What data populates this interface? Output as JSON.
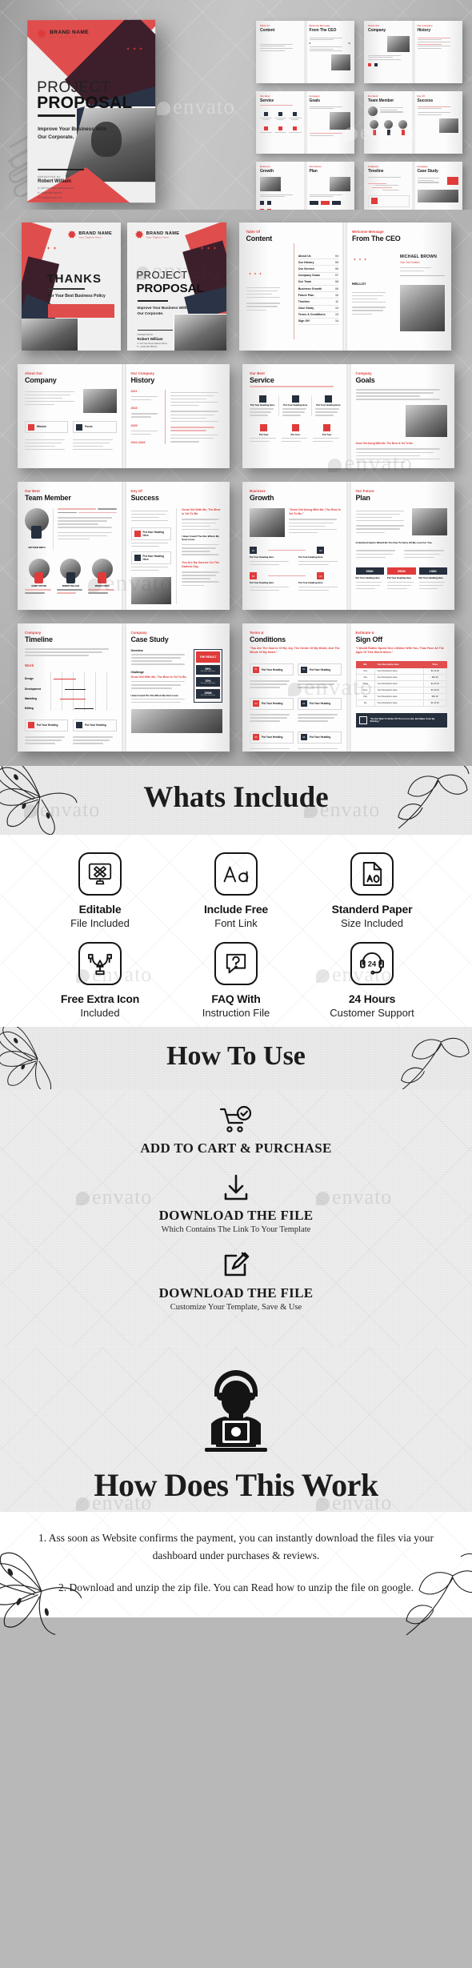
{
  "colors": {
    "accent_red": "#e04d4d",
    "dark_navy": "#2b3446",
    "maroon": "#3d1f2b",
    "ink": "#1a1a1a"
  },
  "cover": {
    "brand_name": "BRAND NAME",
    "brand_tagline": "Your Tagline Here",
    "title_line1": "PROJECT",
    "title_line2": "PROPOSAL",
    "subtitle": "Improve Your Business With Our Corporate.",
    "presented_label": "PRESENTED BY",
    "presented_name": "Robert William",
    "contact_address": "A: 123 Your Street Address Name",
    "contact_phone": "P: +(123) 456 7890 00",
    "contact_mail": "M: user@example.com"
  },
  "thumbnails": [
    {
      "left_kicker": "Table Of",
      "left_title": "Content",
      "right_kicker": "Welcome Message",
      "right_title": "From The CEO"
    },
    {
      "left_kicker": "About Our",
      "left_title": "Company",
      "right_kicker": "Our Company",
      "right_title": "History"
    },
    {
      "left_kicker": "Our Best",
      "left_title": "Service",
      "right_kicker": "Company",
      "right_title": "Goals"
    },
    {
      "left_kicker": "Our Best",
      "left_title": "Team Member",
      "right_kicker": "Key Of",
      "right_title": "Success"
    },
    {
      "left_kicker": "Business",
      "left_title": "Growth",
      "right_kicker": "Our Future",
      "right_title": "Plan"
    },
    {
      "left_kicker": "Company",
      "left_title": "Timeline",
      "right_kicker": "Company",
      "right_title": "Case Study"
    }
  ],
  "covers_row": {
    "thanks_title": "THANKS",
    "thanks_sub": "For Your Best Business Policy",
    "proposal_line1": "PROJECT",
    "proposal_line2": "PROPOSAL",
    "proposal_sub": "Improve Your Business With Our Corporate."
  },
  "spreads": [
    {
      "left": {
        "kicker": "Table Of",
        "title": "Content"
      },
      "right": {
        "kicker": "Welcome Message",
        "title": "From The CEO",
        "person": "MICHAEL BROWN",
        "person_role": "Your Job Position",
        "greeting": "HELLO!"
      },
      "toc": [
        {
          "label": "About Us",
          "page": "04"
        },
        {
          "label": "Our History",
          "page": "05"
        },
        {
          "label": "Our Service",
          "page": "06"
        },
        {
          "label": "Company Goals",
          "page": "07"
        },
        {
          "label": "Our Team",
          "page": "08"
        },
        {
          "label": "Business Growth",
          "page": "09"
        },
        {
          "label": "Future Plan",
          "page": "10"
        },
        {
          "label": "Timeline",
          "page": "11"
        },
        {
          "label": "Case Study",
          "page": "12"
        },
        {
          "label": "Terms & Conditions",
          "page": "13"
        },
        {
          "label": "Sign Off",
          "page": "14"
        }
      ]
    },
    {
      "left": {
        "kicker": "About Our",
        "title": "Company",
        "tag1": "Mission",
        "tag2": "Focus"
      },
      "right": {
        "kicker": "Our Company",
        "title": "History",
        "years": "2021-2026"
      }
    },
    {
      "left": {
        "kicker": "Our Best",
        "title": "Service",
        "cards": [
          "Put Your Heading Here",
          "Put Your Heading Here",
          "Put Your Heading Here"
        ]
      },
      "right": {
        "kicker": "Company",
        "title": "Goals",
        "quote": "Grow Old Along With Me, The Best Is Yet To Be."
      }
    },
    {
      "left": {
        "kicker": "Our Best",
        "title": "Team Member",
        "lead_name": "MATTHEW SMITH",
        "members": [
          "HENRY POTTER",
          "ROBERT WILLIAM",
          "ROBERT PRICE"
        ]
      },
      "right": {
        "kicker": "Key Of",
        "title": "Success",
        "quote": "Grow Old With Me, The Best Is Yet To Be.",
        "item1": "Put Your Heading Here",
        "item2": "Put Your Heading Here"
      }
    },
    {
      "left": {
        "kicker": "Business",
        "title": "Growth",
        "quote": "\"Grow Old Along With Me, The Best Is Yet To Be.\"",
        "steps": [
          "01",
          "02",
          "03",
          "04"
        ],
        "step_label": "Put Your Heading Here"
      },
      "right": {
        "kicker": "Our Future",
        "title": "Plan",
        "stats": [
          "990K",
          "350M",
          "150K"
        ],
        "stat_label": "Put Your Heading Here"
      }
    },
    {
      "left": {
        "kicker": "Company",
        "title": "Timeline",
        "work_label": "Work",
        "rows": [
          "Design",
          "Development",
          "Marketing",
          "Editing"
        ],
        "chip1": "Put Your Heading",
        "chip2": "Put Your Heading"
      },
      "right": {
        "kicker": "Company",
        "title": "Case Study",
        "sec1": "Overview",
        "sec2": "Challenge",
        "result": "THE RESULT",
        "metrics": [
          "99%",
          "70%",
          "250M"
        ],
        "metric_sub": "Put Your Text Here"
      }
    },
    {
      "left": {
        "kicker": "Terms &",
        "title": "Conditions",
        "quote": "\"You Are The Source Of My Joy, The Center Of My World, And The Whole Of My Heart.\"",
        "items": [
          "01",
          "02",
          "03",
          "04",
          "05",
          "06"
        ],
        "item_label": "Put Your Heading"
      },
      "right": {
        "kicker": "Estimate &",
        "title": "Sign Off",
        "quote": "\"I Would Rather Spend One Lifetime With You, Than Face All The Ages Of This World Alone.\"",
        "table_headers": [
          "NO.",
          "Your Description Here",
          "Price"
        ],
        "table_rows": [
          {
            "no": "One",
            "desc": "Your Description Here",
            "price": "$1,00.00"
          },
          {
            "no": "Two",
            "desc": "Your Description Here",
            "price": "$60.00"
          },
          {
            "no": "Three",
            "desc": "Your Description Here",
            "price": "$1,00.00"
          },
          {
            "no": "Four",
            "desc": "Your Description Here",
            "price": "$1,00.00"
          },
          {
            "no": "Five",
            "desc": "Your Description Here",
            "price": "$60.00"
          },
          {
            "no": "Six",
            "desc": "Your Description Here",
            "price": "$1,00.00"
          }
        ],
        "footer_quote": "\"Do Not Wait To Strike Till The Iron Is Hot, But Make It Hot By Striking.\""
      }
    }
  ],
  "whats_include": {
    "title": "Whats Include",
    "features": [
      {
        "icon": "editable-monitor-icon",
        "line1": "Editable",
        "line2": "File Included"
      },
      {
        "icon": "font-aa-icon",
        "line1": "Include Free",
        "line2": "Font Link"
      },
      {
        "icon": "paper-a0-icon",
        "line1": "Standerd Paper",
        "line2": "Size Included"
      },
      {
        "icon": "pen-tool-icon",
        "line1": "Free Extra Icon",
        "line2": "Included"
      },
      {
        "icon": "faq-question-icon",
        "line1": "FAQ With",
        "line2": "Instruction File"
      },
      {
        "icon": "headset-24-icon",
        "line1": "24 Hours",
        "line2": "Customer Support"
      }
    ]
  },
  "how_to_use": {
    "title": "How To Use",
    "steps": [
      {
        "icon": "cart-check-icon",
        "line1": "ADD TO CART & PURCHASE",
        "line2": ""
      },
      {
        "icon": "download-icon",
        "line1": "DOWNLOAD THE FILE",
        "line2": "Which Contains The Link To Your Template"
      },
      {
        "icon": "edit-pencil-icon",
        "line1": "DOWNLOAD THE FILE",
        "line2": "Customize Your Template, Save & Use"
      }
    ]
  },
  "how_does_this_work": {
    "icon": "person-laptop-icon",
    "title": "How Does This Work",
    "paragraph1": "1. Ass soon as Website confirms the payment, you can instantly download the files via your dashboard under purchases & reviews.",
    "paragraph2": "2. Download and unzip the zip file. You can Read how to unzip the file on google."
  },
  "watermark": {
    "text": "envato"
  }
}
